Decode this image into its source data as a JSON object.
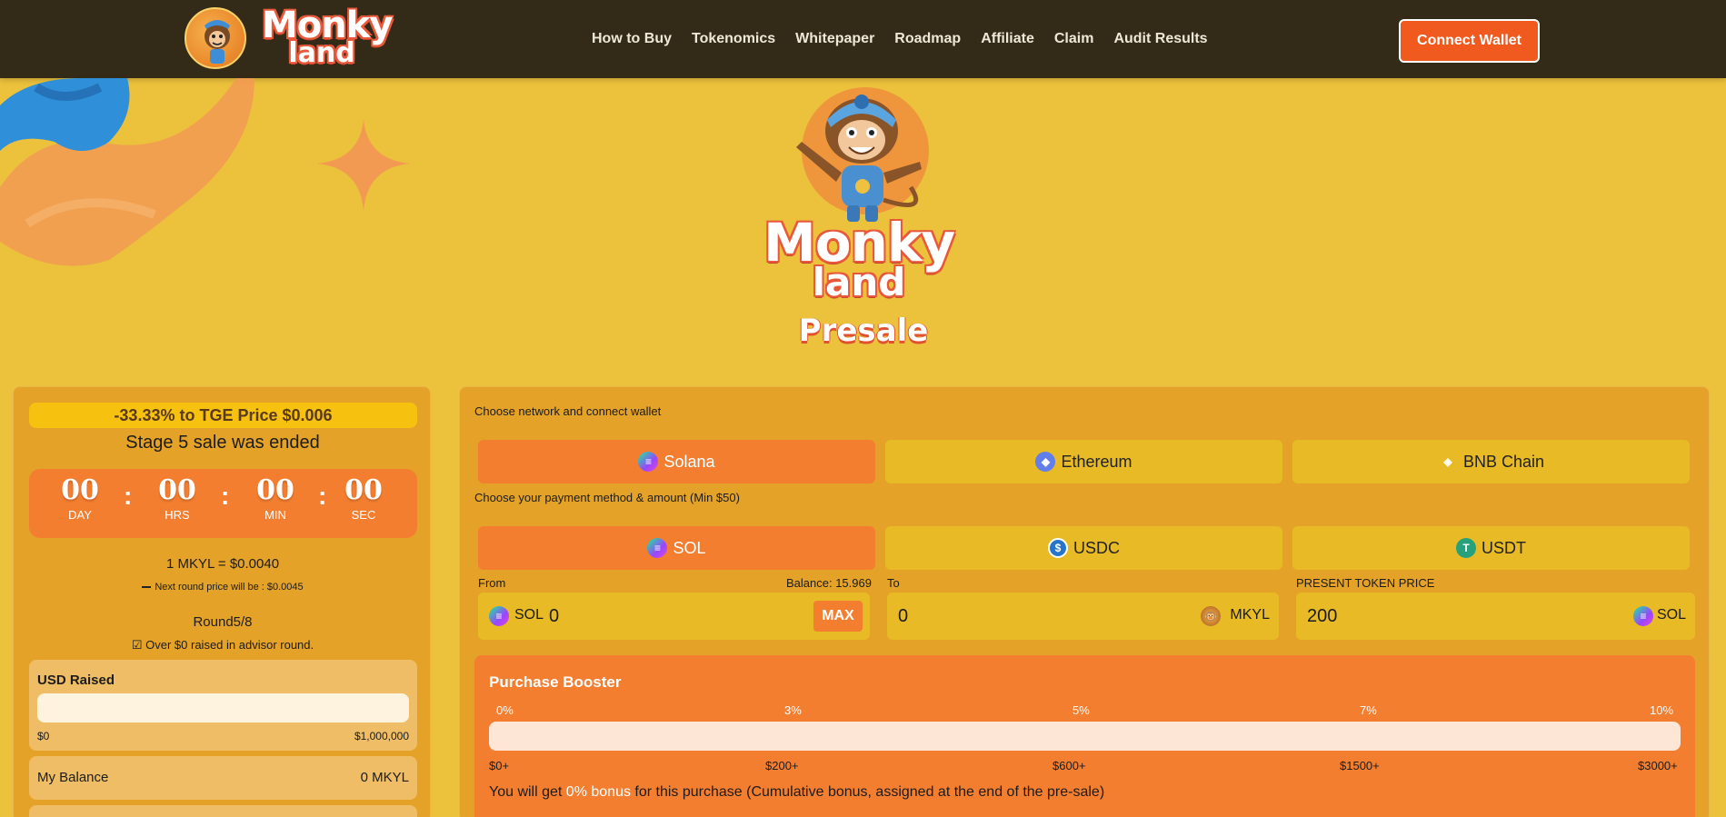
{
  "nav": {
    "brand_line1": "Monky",
    "brand_line2": "land",
    "links": [
      "How to Buy",
      "Tokenomics",
      "Whitepaper",
      "Roadmap",
      "Affiliate",
      "Claim",
      "Audit Results"
    ],
    "connect_label": "Connect Wallet"
  },
  "hero": {
    "brand_line1": "Monky",
    "brand_line2": "land",
    "title": "Presale"
  },
  "left": {
    "tge_badge": "-33.33% to TGE Price $0.006",
    "stage_text": "Stage 5 sale was ended",
    "timer": [
      {
        "value": "00",
        "label": "DAY"
      },
      {
        "value": "00",
        "label": "HRS"
      },
      {
        "value": "00",
        "label": "MIN"
      },
      {
        "value": "00",
        "label": "SEC"
      }
    ],
    "timer_sep": ":",
    "price_line": "1 MKYL = $0.0040",
    "next_price": "Next round price will be : $0.0045",
    "round": "Round5/8",
    "raised_note": "☑ Over $0 raised in advisor round.",
    "usd_raised_title": "USD Raised",
    "usd_raised_progress": 0,
    "usd_min": "$0",
    "usd_max": "$1,000,000",
    "balance_label": "My Balance",
    "balance_value": "0 MKYL"
  },
  "right": {
    "network_label": "Choose network and connect wallet",
    "networks": [
      {
        "label": "Solana",
        "icon": "solana-icon",
        "active": true
      },
      {
        "label": "Ethereum",
        "icon": "ethereum-icon",
        "active": false
      },
      {
        "label": "BNB Chain",
        "icon": "bnb-icon",
        "active": false
      }
    ],
    "payment_label": "Choose your payment method & amount (Min $50)",
    "payments": [
      {
        "label": "SOL",
        "icon": "solana-icon",
        "active": true
      },
      {
        "label": "USDC",
        "icon": "usdc-icon",
        "active": false
      },
      {
        "label": "USDT",
        "icon": "usdt-icon",
        "active": false
      }
    ],
    "from_label": "From",
    "balance_label": "Balance: 15.969",
    "from_ticker": "SOL",
    "from_value": "0",
    "max_label": "MAX",
    "to_label": "To",
    "to_value": "0",
    "to_ticker": "MKYL",
    "price_label": "PRESENT TOKEN PRICE",
    "price_value": "200",
    "price_ticker": "SOL",
    "booster": {
      "title": "Purchase Booster",
      "percents": [
        "0%",
        "3%",
        "5%",
        "7%",
        "10%"
      ],
      "amounts": [
        "$0+",
        "$200+",
        "$600+",
        "$1500+",
        "$3000+"
      ],
      "progress": 0,
      "note_prefix": "You will get ",
      "note_highlight": "0% bonus",
      "note_suffix": " for this purchase (Cumulative bonus, assigned at the end of the pre-sale)"
    }
  },
  "colors": {
    "page_bg": "#ecc13c",
    "nav_bg": "#332b18",
    "accent": "#f47e30",
    "connect_btn": "#f15a1f",
    "card_bg": "#e5a228"
  }
}
